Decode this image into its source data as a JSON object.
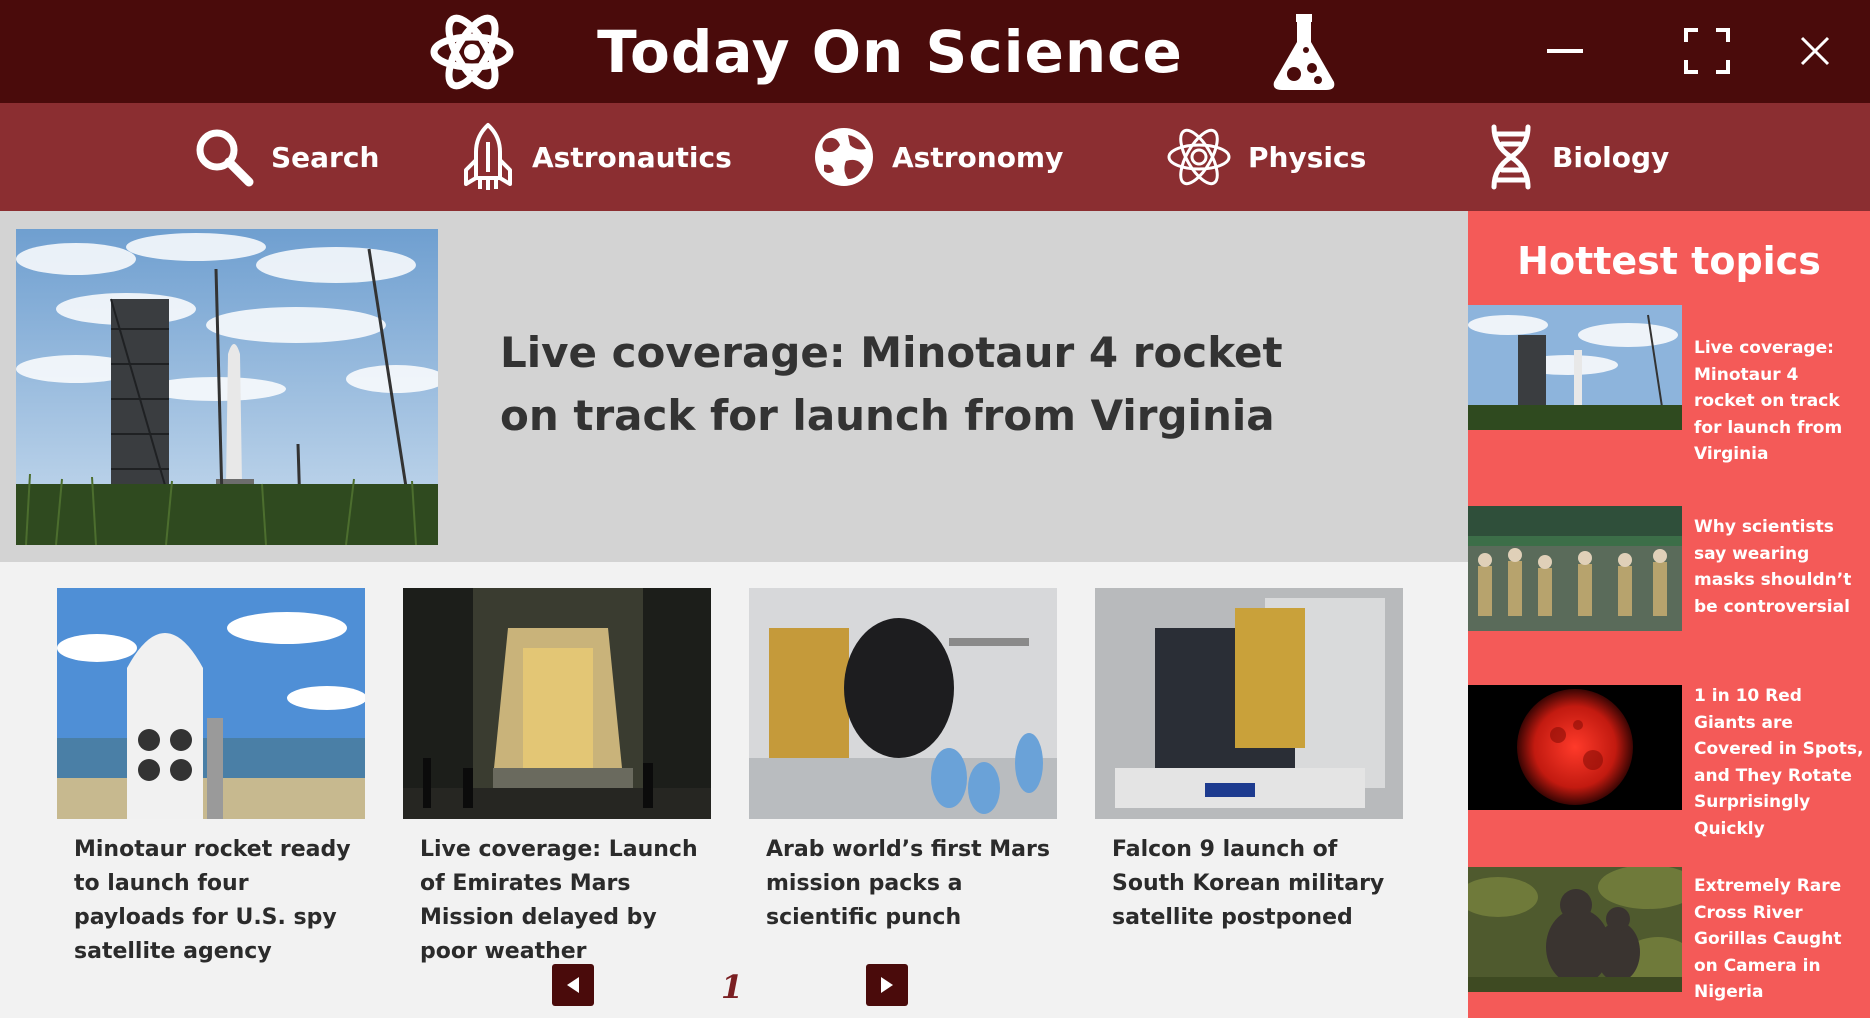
{
  "app": {
    "title": "Today On Science",
    "colors": {
      "titlebar": "#4a0b0b",
      "navbar": "#8b2e31",
      "featured_bg": "#d3d3d3",
      "sidebar_bg": "#f45a58",
      "page_bg": "#f2f2f2"
    }
  },
  "window_controls": {
    "minimize_icon": "minimize-icon",
    "maximize_icon": "maximize-icon",
    "close_icon": "close-icon"
  },
  "nav": {
    "items": [
      {
        "label": "Search",
        "icon": "search-icon"
      },
      {
        "label": "Astronautics",
        "icon": "rocket-icon"
      },
      {
        "label": "Astronomy",
        "icon": "planet-icon"
      },
      {
        "label": "Physics",
        "icon": "atom-icon"
      },
      {
        "label": "Biology",
        "icon": "dna-icon"
      }
    ]
  },
  "featured": {
    "title": "Live coverage: Minotaur 4 rocket on track for launch from Virginia",
    "image": "launch-pad-photo"
  },
  "articles": [
    {
      "title": "Minotaur rocket ready to launch four payloads for U.S. spy satellite agency",
      "image": "rocket-fairing-photo"
    },
    {
      "title": "Live coverage: Launch of Emirates Mars Mission delayed by poor weather",
      "image": "night-rollout-photo"
    },
    {
      "title": "Arab world’s first Mars mission packs a scientific punch",
      "image": "clean-room-probe-photo"
    },
    {
      "title": "Falcon 9 launch of South Korean military satellite postponed",
      "image": "satellite-container-photo"
    }
  ],
  "pagination": {
    "current_page": "1",
    "prev_icon": "prev-arrow-icon",
    "next_icon": "next-arrow-icon"
  },
  "sidebar": {
    "heading": "Hottest topics",
    "items": [
      {
        "title": "Live coverage: Minotaur 4 rocket on track for launch from Virginia",
        "image": "launch-pad-photo"
      },
      {
        "title": "Why scientists say wearing masks shouldn’t be controversial",
        "image": "crowd-market-photo"
      },
      {
        "title": "1 in 10 Red Giants are Covered in Spots, and They Rotate Surprisingly Quickly",
        "image": "red-giant-photo"
      },
      {
        "title": "Extremely Rare Cross River Gorillas Caught on Camera in Nigeria",
        "image": "gorillas-photo"
      }
    ]
  }
}
